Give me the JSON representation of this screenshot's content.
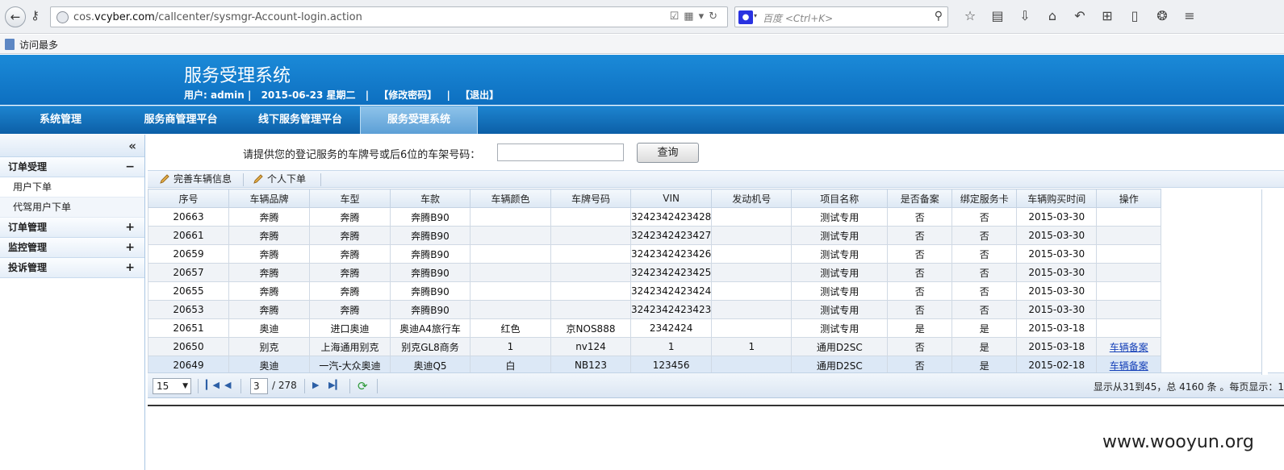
{
  "browser": {
    "url_prefix": "cos.",
    "url_domain": "vcyber.com",
    "url_path": "/callcenter/sysmgr-Account-login.action",
    "search_engine": "百度",
    "search_placeholder": "<Ctrl+K>",
    "bookmark_label": "访问最多"
  },
  "app": {
    "title": "服务受理系统",
    "user": "用户: admin |",
    "date": "2015-06-23 星期二",
    "sep": "|",
    "change_password": "【修改密码】",
    "logout": "【退出】"
  },
  "nav": [
    "系统管理",
    "服务商管理平台",
    "线下服务管理平台",
    "服务受理系统"
  ],
  "sidebar": {
    "collapse": "«",
    "groups": [
      {
        "label": "订单受理",
        "toggle": "−"
      },
      {
        "label": "订单管理",
        "toggle": "+"
      },
      {
        "label": "监控管理",
        "toggle": "+"
      },
      {
        "label": "投诉管理",
        "toggle": "+"
      }
    ],
    "sub_items": [
      "用户下单",
      "代驾用户下单"
    ]
  },
  "query": {
    "label": "请提供您的登记服务的车牌号或后6位的车架号码：",
    "input_value": "",
    "button": "查询"
  },
  "toolbar": {
    "complete_vehicle": "完善车辆信息",
    "personal_order": "个人下单"
  },
  "table": {
    "headers": [
      "序号",
      "车辆品牌",
      "车型",
      "车款",
      "车辆颜色",
      "车牌号码",
      "VIN",
      "发动机号",
      "项目名称",
      "是否备案",
      "绑定服务卡",
      "车辆购买时间",
      "操作"
    ],
    "rows": [
      [
        "20663",
        "奔腾",
        "奔腾",
        "奔腾B90",
        "",
        "",
        "3242342423428",
        "",
        "测试专用",
        "否",
        "否",
        "2015-03-30",
        ""
      ],
      [
        "20661",
        "奔腾",
        "奔腾",
        "奔腾B90",
        "",
        "",
        "3242342423427",
        "",
        "测试专用",
        "否",
        "否",
        "2015-03-30",
        ""
      ],
      [
        "20659",
        "奔腾",
        "奔腾",
        "奔腾B90",
        "",
        "",
        "3242342423426",
        "",
        "测试专用",
        "否",
        "否",
        "2015-03-30",
        ""
      ],
      [
        "20657",
        "奔腾",
        "奔腾",
        "奔腾B90",
        "",
        "",
        "3242342423425",
        "",
        "测试专用",
        "否",
        "否",
        "2015-03-30",
        ""
      ],
      [
        "20655",
        "奔腾",
        "奔腾",
        "奔腾B90",
        "",
        "",
        "3242342423424",
        "",
        "测试专用",
        "否",
        "否",
        "2015-03-30",
        ""
      ],
      [
        "20653",
        "奔腾",
        "奔腾",
        "奔腾B90",
        "",
        "",
        "3242342423423",
        "",
        "测试专用",
        "否",
        "否",
        "2015-03-30",
        ""
      ],
      [
        "20651",
        "奥迪",
        "进口奥迪",
        "奥迪A4旅行车",
        "红色",
        "京NOS888",
        "2342424",
        "",
        "测试专用",
        "是",
        "是",
        "2015-03-18",
        ""
      ],
      [
        "20650",
        "别克",
        "上海通用别克",
        "别克GL8商务",
        "1",
        "nv124",
        "1",
        "1",
        "通用D2SC",
        "否",
        "是",
        "2015-03-18",
        "车辆备案"
      ],
      [
        "20649",
        "奥迪",
        "一汽-大众奥迪",
        "奥迪Q5",
        "白",
        "NB123",
        "123456",
        "",
        "通用D2SC",
        "否",
        "是",
        "2015-02-18",
        "车辆备案"
      ]
    ]
  },
  "pager": {
    "page_size": "15",
    "current_page": "3",
    "total_pages": "/ 278",
    "info": "显示从31到45，总 4160 条 。每页显示：1"
  },
  "watermark": "www.wooyun.org"
}
